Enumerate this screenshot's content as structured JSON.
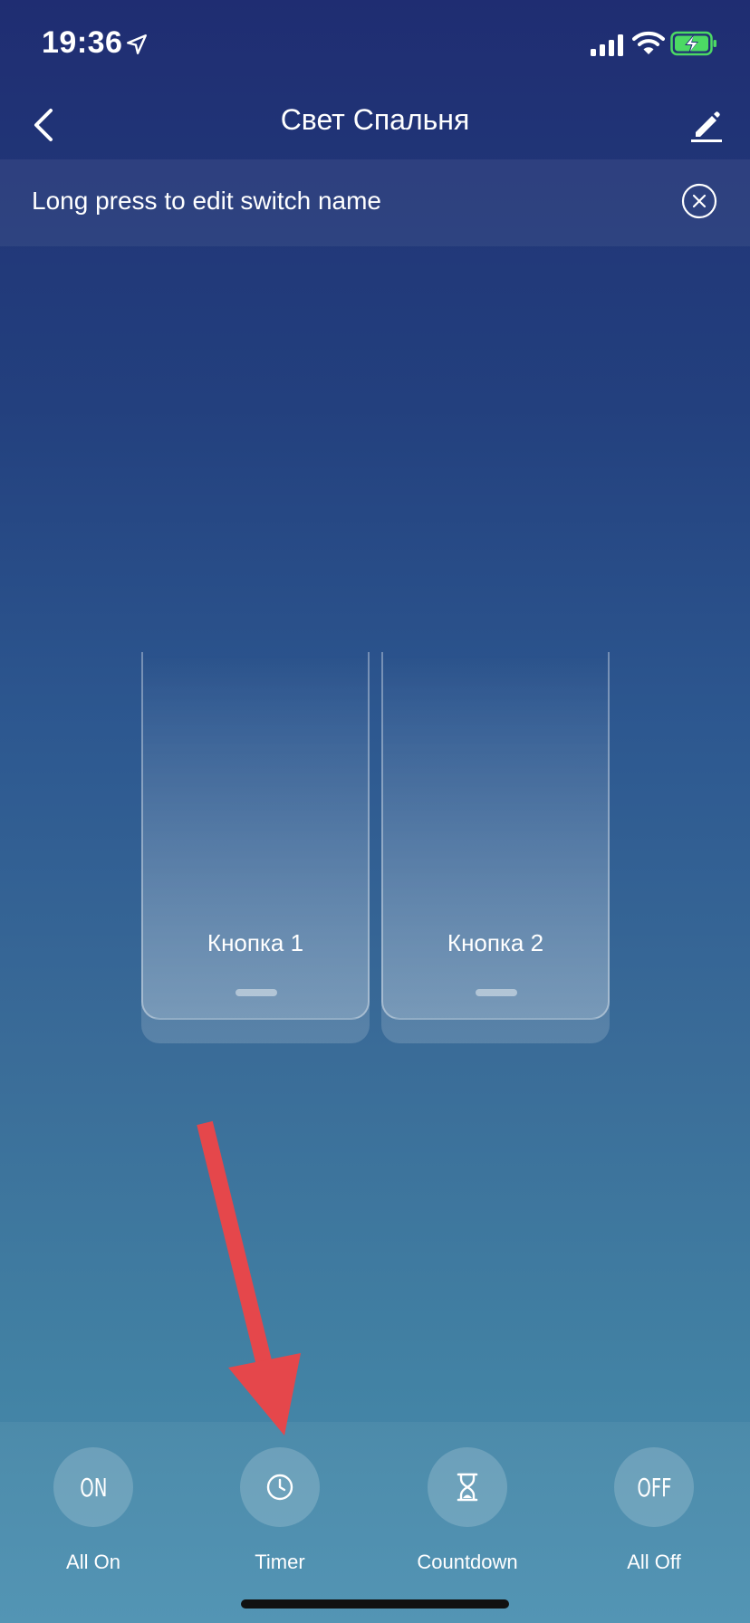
{
  "status_bar": {
    "time": "19:36",
    "icons": [
      "location-arrow-icon",
      "cellular-signal-icon",
      "wifi-icon",
      "battery-charging-icon"
    ],
    "battery_color": "#4cd964"
  },
  "nav": {
    "title": "Свет Спальня",
    "back_icon": "chevron-left-icon",
    "edit_icon": "pencil-icon"
  },
  "hint": {
    "text": "Long press to edit switch name",
    "close_icon": "close-circle-icon"
  },
  "switches": [
    {
      "label": "Кнопка 1"
    },
    {
      "label": "Кнопка 2"
    }
  ],
  "actions": [
    {
      "label": "All On",
      "icon_text": "ON",
      "icon": "on-icon"
    },
    {
      "label": "Timer",
      "icon": "clock-icon"
    },
    {
      "label": "Countdown",
      "icon": "hourglass-icon"
    },
    {
      "label": "All Off",
      "icon_text": "OFF",
      "icon": "off-icon"
    }
  ],
  "colors": {
    "gradient_top": "#1f2d72",
    "gradient_bottom": "#4a90b0",
    "annotation_arrow": "#e5474b"
  }
}
